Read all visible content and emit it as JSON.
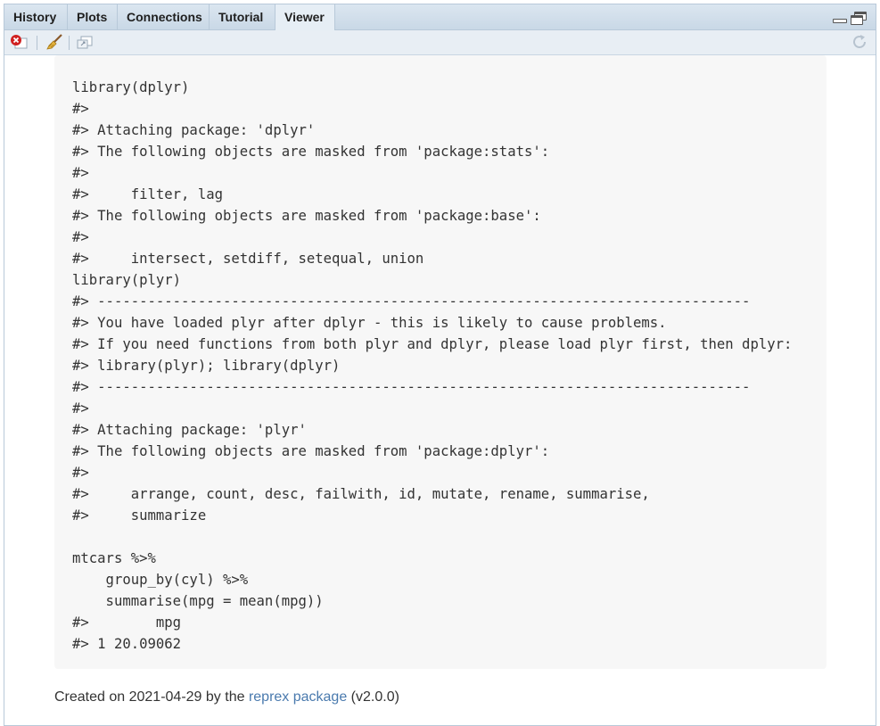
{
  "tabs": [
    {
      "label": "History"
    },
    {
      "label": "Plots"
    },
    {
      "label": "Connections"
    },
    {
      "label": "Tutorial"
    },
    {
      "label": "Viewer"
    }
  ],
  "active_tab": "Viewer",
  "code": {
    "text": "library(dplyr)\n#> \n#> Attaching package: 'dplyr'\n#> The following objects are masked from 'package:stats':\n#> \n#>     filter, lag\n#> The following objects are masked from 'package:base':\n#> \n#>     intersect, setdiff, setequal, union\nlibrary(plyr)\n#> ------------------------------------------------------------------------------\n#> You have loaded plyr after dplyr - this is likely to cause problems.\n#> If you need functions from both plyr and dplyr, please load plyr first, then dplyr:\n#> library(plyr); library(dplyr)\n#> ------------------------------------------------------------------------------\n#> \n#> Attaching package: 'plyr'\n#> The following objects are masked from 'package:dplyr':\n#> \n#>     arrange, count, desc, failwith, id, mutate, rename, summarise,\n#>     summarize\n\nmtcars %>%\n    group_by(cyl) %>%\n    summarise(mpg = mean(mpg))\n#>        mpg\n#> 1 20.09062"
  },
  "caption": {
    "prefix": "Created on 2021-04-29 by the ",
    "link": "reprex package",
    "suffix": " (v2.0.0)"
  }
}
